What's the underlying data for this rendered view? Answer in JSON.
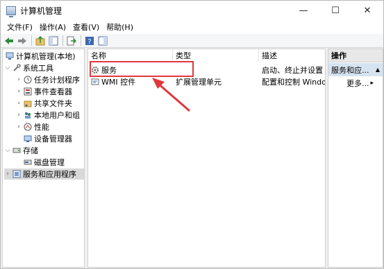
{
  "window": {
    "title": "计算机管理",
    "controls": {
      "minimize": "—",
      "maximize": "☐",
      "close": "✕"
    }
  },
  "menu": [
    "文件(F)",
    "操作(A)",
    "查看(V)",
    "帮助(H)"
  ],
  "tree": {
    "root": "计算机管理(本地)",
    "system_tools": "系统工具",
    "task_scheduler": "任务计划程序",
    "event_viewer": "事件查看器",
    "shared_folders": "共享文件夹",
    "local_users": "本地用户和组",
    "performance": "性能",
    "device_manager": "设备管理器",
    "storage": "存储",
    "disk_management": "磁盘管理",
    "services_apps": "服务和应用程序"
  },
  "list": {
    "columns": {
      "name": "名称",
      "type": "类型",
      "desc": "描述"
    },
    "rows": [
      {
        "name": "服务",
        "type": "",
        "desc": "启动、终止并设置 W"
      },
      {
        "name": "WMI 控件",
        "type": "扩展管理单元",
        "desc": "配置和控制 Window"
      }
    ]
  },
  "actions": {
    "header": "操作",
    "group": "服务和应...",
    "more": "更多..."
  },
  "colors": {
    "highlight": "#e0383c",
    "selection": "#d9d9d9",
    "actions_group_bg": "#d6e3f1"
  }
}
